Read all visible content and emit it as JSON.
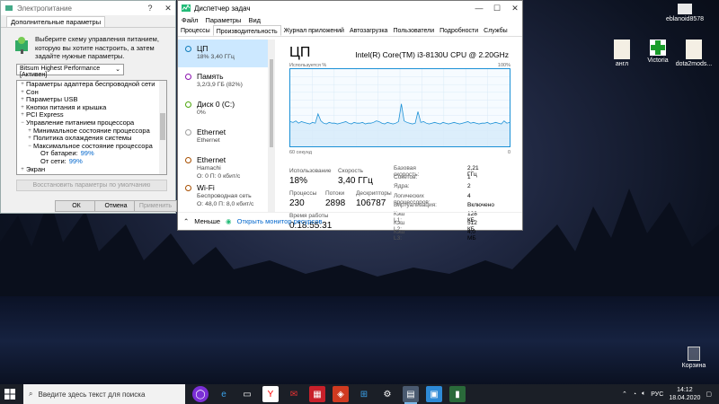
{
  "power_dialog": {
    "title": "Электропитание",
    "tab": "Дополнительные параметры",
    "description": "Выберите схему управления питанием, которую вы хотите настроить, а затем задайте нужные параметры.",
    "plan_selected": "Bitsum Highest Performance [Активен]",
    "tree": [
      {
        "exp": "+",
        "indent": 0,
        "label": "Параметры адаптера беспроводной сети"
      },
      {
        "exp": "+",
        "indent": 0,
        "label": "Сон"
      },
      {
        "exp": "+",
        "indent": 0,
        "label": "Параметры USB"
      },
      {
        "exp": "+",
        "indent": 0,
        "label": "Кнопки питания и крышка"
      },
      {
        "exp": "+",
        "indent": 0,
        "label": "PCI Express"
      },
      {
        "exp": "−",
        "indent": 0,
        "label": "Управление питанием процессора"
      },
      {
        "exp": "+",
        "indent": 1,
        "label": "Минимальное состояние процессора"
      },
      {
        "exp": "+",
        "indent": 1,
        "label": "Политика охлаждения системы"
      },
      {
        "exp": "−",
        "indent": 1,
        "label": "Максимальное состояние процессора"
      },
      {
        "exp": "",
        "indent": 2,
        "label": "От батареи:",
        "value": "99%"
      },
      {
        "exp": "",
        "indent": 2,
        "label": "От сети:",
        "value": "99%"
      },
      {
        "exp": "+",
        "indent": 0,
        "label": "Экран"
      }
    ],
    "restore_button": "Восстановить параметры по умолчанию",
    "ok": "ОК",
    "cancel": "Отмена",
    "apply": "Применить"
  },
  "task_manager": {
    "title": "Диспетчер задач",
    "menu": [
      "Файл",
      "Параметры",
      "Вид"
    ],
    "tabs": [
      "Процессы",
      "Производительность",
      "Журнал приложений",
      "Автозагрузка",
      "Пользователи",
      "Подробности",
      "Службы"
    ],
    "active_tab": 1,
    "side": [
      {
        "name": "ЦП",
        "sub1": "18% 3,40 ГГц",
        "sub2": "",
        "color": "#117dbb",
        "selected": true
      },
      {
        "name": "Память",
        "sub1": "3,2/3,9 ГБ (82%)",
        "sub2": "",
        "color": "#8b12ae",
        "selected": false
      },
      {
        "name": "Диск 0 (C:)",
        "sub1": "0%",
        "sub2": "",
        "color": "#4da60c",
        "selected": false
      },
      {
        "name": "Ethernet",
        "sub1": "Ethernet",
        "sub2": "",
        "color": "#a0a0a0",
        "selected": false
      },
      {
        "name": "Ethernet",
        "sub1": "Hamachi",
        "sub2": "О: 0 П: 0 кбит/с",
        "color": "#a74f01",
        "selected": false
      },
      {
        "name": "Wi-Fi",
        "sub1": "Беспроводная сеть",
        "sub2": "О: 48,0 П: 8,0 кбит/с",
        "color": "#a74f01",
        "selected": false
      }
    ],
    "cpu_title": "ЦП",
    "cpu_model": "Intel(R) Core(TM) i3-8130U CPU @ 2.20GHz",
    "graph_label": "Используется %",
    "graph_max": "100%",
    "graph_time": "60 секунд",
    "graph_min": "0",
    "graph_values": [
      32,
      31,
      33,
      30,
      32,
      31,
      30,
      29,
      31,
      30,
      42,
      33,
      30,
      29,
      31,
      30,
      30,
      29,
      30,
      31,
      32,
      30,
      29,
      31,
      30,
      30,
      31,
      29,
      30,
      30,
      31,
      33,
      32,
      30,
      29,
      31,
      30,
      29,
      30,
      32,
      55,
      33,
      31,
      30,
      29,
      30,
      45,
      31,
      32,
      30,
      29,
      30,
      31,
      30,
      29,
      31,
      30,
      29,
      30,
      31,
      30,
      29,
      30,
      31,
      32,
      30,
      31,
      30,
      29,
      30,
      30,
      31,
      29,
      30,
      31,
      30,
      29,
      33,
      30,
      31
    ],
    "stats": {
      "util_label": "Использование",
      "util": "18%",
      "speed_label": "Скорость",
      "speed": "3,40 ГГц",
      "proc_label": "Процессы",
      "proc": "230",
      "threads_label": "Потоки",
      "threads": "2898",
      "handles_label": "Дескрипторы",
      "handles": "106787",
      "uptime_label": "Время работы",
      "uptime": "0:18:55:31"
    },
    "details": [
      {
        "k": "Базовая скорость:",
        "v": "2,21 ГГц"
      },
      {
        "k": "Сокетов:",
        "v": "1"
      },
      {
        "k": "Ядра:",
        "v": "2"
      },
      {
        "k": "Логических процессоров:",
        "v": "4"
      },
      {
        "k": "Виртуализация:",
        "v": "Включено"
      },
      {
        "k": "Кэш L1:",
        "v": "128 КБ"
      },
      {
        "k": "Кэш L2:",
        "v": "512 КБ"
      },
      {
        "k": "Кэш L3:",
        "v": "4,0 МБ"
      }
    ],
    "less": "Меньше",
    "resmon": "Открыть монитор ресурсов"
  },
  "desktop_icons": [
    "eblanoid8578",
    "англ",
    "Victoria",
    "dota2mods...",
    "Корзина"
  ],
  "taskbar": {
    "search_placeholder": "Введите здесь текст для поиска",
    "lang": "РУС",
    "time": "14:12",
    "date": "18.04.2020"
  }
}
